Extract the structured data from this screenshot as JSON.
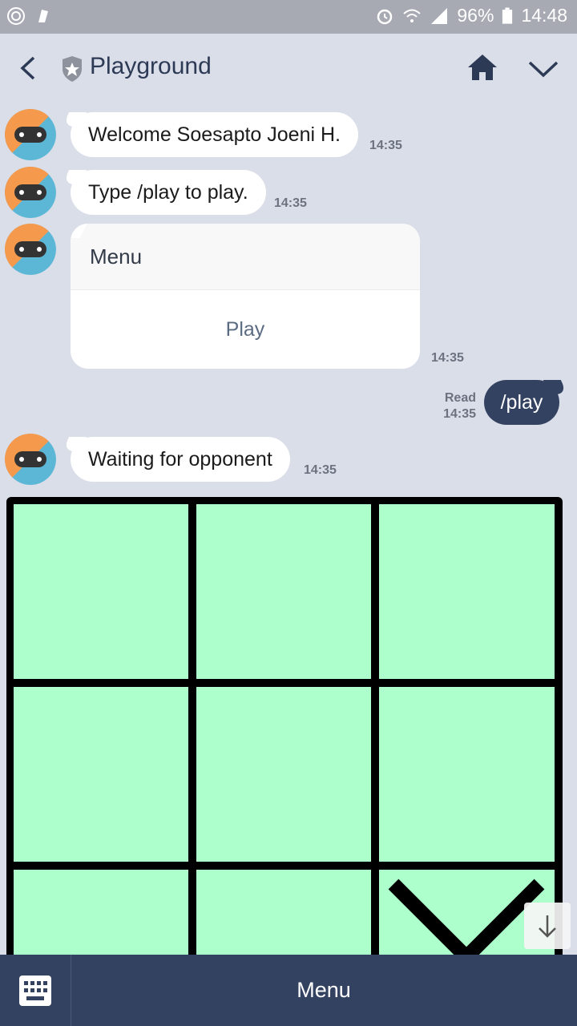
{
  "status_bar": {
    "battery": "96%",
    "time": "14:48"
  },
  "header": {
    "title": "Playground"
  },
  "messages": [
    {
      "text": "Welcome Soesapto Joeni H.",
      "time": "14:35"
    },
    {
      "text": "Type /play to play.",
      "time": "14:35"
    },
    {
      "menu_title": "Menu",
      "menu_action": "Play",
      "time": "14:35"
    },
    {
      "outgoing_text": "/play",
      "read_label": "Read",
      "time": "14:35"
    },
    {
      "text": "Waiting for opponent",
      "time": "14:35"
    }
  ],
  "board": {
    "cells": [
      "",
      "",
      "",
      "",
      "",
      "",
      "",
      "",
      "X"
    ],
    "cell_color": "#adffcc"
  },
  "bottom_bar": {
    "menu_label": "Menu"
  },
  "colors": {
    "accent": "#344262",
    "background": "#dadee8"
  }
}
